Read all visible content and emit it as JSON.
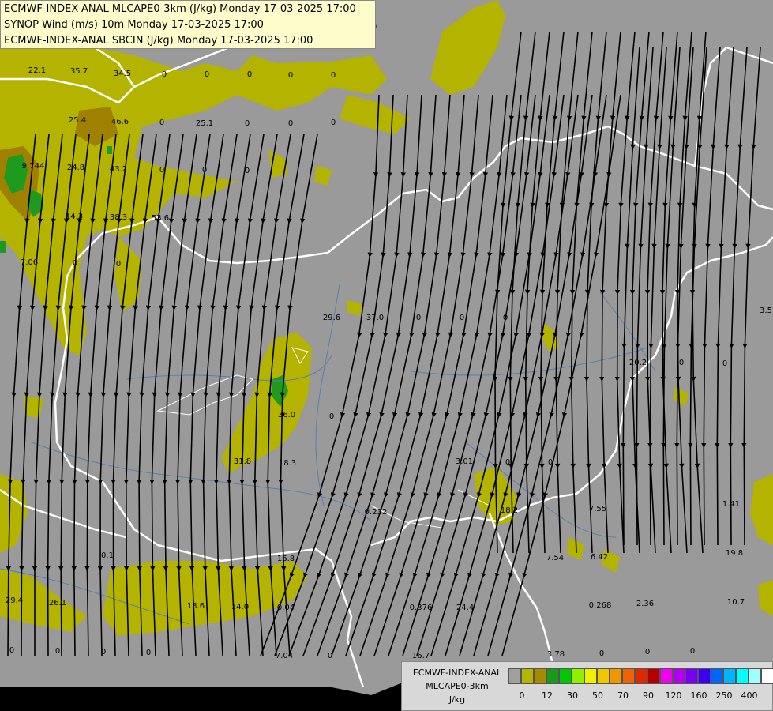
{
  "titles": [
    "ECMWF-INDEX-ANAL MLCAPE0-3km (J/kg) Monday 17-03-2025 17:00",
    "SYNOP Wind (m/s) 10m Monday 17-03-2025 17:00",
    "ECMWF-INDEX-ANAL SBCIN (J/kg) Monday 17-03-2025 17:00"
  ],
  "legend": {
    "title_lines": [
      "ECMWF-INDEX-ANAL",
      "MLCAPE0-3km",
      "J/kg"
    ],
    "colors": [
      "#a0a0a0",
      "#b5b500",
      "#a88a00",
      "#1a9a1a",
      "#00c800",
      "#90f000",
      "#f0f000",
      "#f0c800",
      "#f09600",
      "#f06400",
      "#e02800",
      "#b40000",
      "#f000f0",
      "#b400f0",
      "#7800f0",
      "#3c00f0",
      "#0064ff",
      "#00b4ff",
      "#00ffff",
      "#a0ffff",
      "#ffffff"
    ],
    "ticks": [
      "0",
      "12",
      "30",
      "50",
      "70",
      "90",
      "120",
      "160",
      "250",
      "400"
    ]
  },
  "palette": {
    "background": "#9a9a9a",
    "cape_low": "#b3b300",
    "cape_mid": "#a08000",
    "cape_high": "#1e9a1e",
    "border": "#ffffff",
    "river": "#5a7faa"
  },
  "stations": [
    {
      "v": "22.1"
    },
    {
      "v": "35.7"
    },
    {
      "v": "34.5"
    },
    {
      "v": "0"
    },
    {
      "v": "0"
    },
    {
      "v": "0"
    },
    {
      "v": "0"
    },
    {
      "v": "0"
    },
    {
      "v": "0"
    },
    {
      "v": "25.4"
    },
    {
      "v": "46.6"
    },
    {
      "v": "0"
    },
    {
      "v": "25.1"
    },
    {
      "v": "0"
    },
    {
      "v": "0"
    },
    {
      "v": "0"
    },
    {
      "v": "9.744"
    },
    {
      "v": "24.8"
    },
    {
      "v": "43.2"
    },
    {
      "v": "0"
    },
    {
      "v": "0"
    },
    {
      "v": "0"
    },
    {
      "v": "14.3"
    },
    {
      "v": "38.3"
    },
    {
      "v": "53.6"
    },
    {
      "v": "7.06"
    },
    {
      "v": "0"
    },
    {
      "v": "0"
    },
    {
      "v": "29.6"
    },
    {
      "v": "37.0"
    },
    {
      "v": "0"
    },
    {
      "v": "0"
    },
    {
      "v": "0"
    },
    {
      "v": "36.0"
    },
    {
      "v": "0"
    },
    {
      "v": "20.2"
    },
    {
      "v": "0"
    },
    {
      "v": "0"
    },
    {
      "v": "31.8"
    },
    {
      "v": "18.3"
    },
    {
      "v": "3.01"
    },
    {
      "v": "0"
    },
    {
      "v": "0"
    },
    {
      "v": "0.232"
    },
    {
      "v": "18.2"
    },
    {
      "v": "7.55"
    },
    {
      "v": "1.41"
    },
    {
      "v": "0.1"
    },
    {
      "v": "16.8"
    },
    {
      "v": "7.54"
    },
    {
      "v": "6.42"
    },
    {
      "v": "19.8"
    },
    {
      "v": "29.4"
    },
    {
      "v": "26.1"
    },
    {
      "v": "13.6"
    },
    {
      "v": "14.0"
    },
    {
      "v": "0.04"
    },
    {
      "v": "0.376"
    },
    {
      "v": "24.4"
    },
    {
      "v": "0.268"
    },
    {
      "v": "2.36"
    },
    {
      "v": "10.7"
    },
    {
      "v": "0"
    },
    {
      "v": "0"
    },
    {
      "v": "0"
    },
    {
      "v": "0"
    },
    {
      "v": "7.04"
    },
    {
      "v": "0"
    },
    {
      "v": "16.7"
    },
    {
      "v": "3.78"
    },
    {
      "v": "0"
    },
    {
      "v": "0"
    },
    {
      "v": "0"
    },
    {
      "v": "3.5"
    }
  ]
}
